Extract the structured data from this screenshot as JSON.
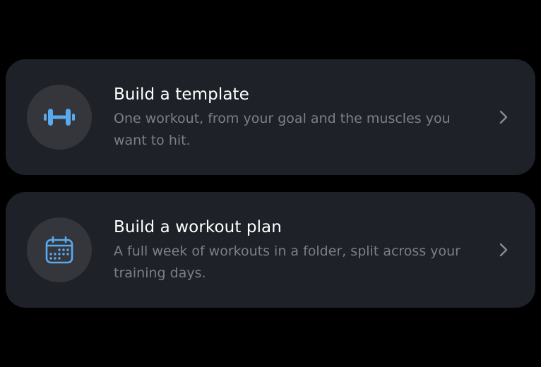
{
  "options": [
    {
      "title": "Build a template",
      "description": "One workout, from your goal and the muscles you want to hit.",
      "icon": "dumbbell-icon"
    },
    {
      "title": "Build a workout plan",
      "description": "A full week of workouts in a folder, split across your training days.",
      "icon": "calendar-icon"
    }
  ],
  "colors": {
    "background": "#000000",
    "card": "#1f2128",
    "icon_circle": "#34363b",
    "accent": "#5aaaf0",
    "title": "#ffffff",
    "description": "#7e7f85",
    "chevron": "#8a8b90"
  }
}
